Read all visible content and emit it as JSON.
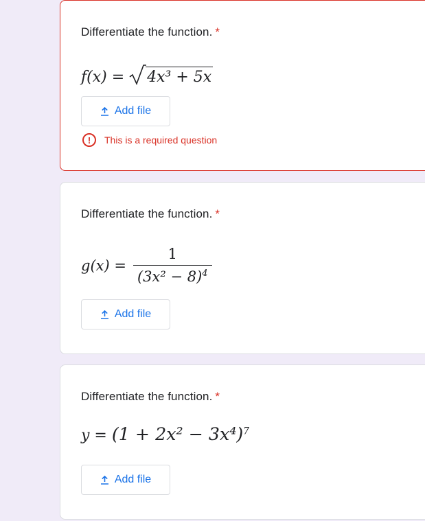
{
  "questions": [
    {
      "title": "Differentiate the function.",
      "required_mark": "*",
      "math": {
        "lhs": "f(x) =",
        "sqrt_content": "4x³ + 5x"
      },
      "add_file_label": "Add file",
      "error_text": "This is a required question"
    },
    {
      "title": "Differentiate the function.",
      "required_mark": "*",
      "math": {
        "lhs": "g(x) =",
        "numerator": "1",
        "denominator_base": "(3x² − 8)",
        "denominator_exp": "4"
      },
      "add_file_label": "Add file"
    },
    {
      "title": "Differentiate the function.",
      "required_mark": "*",
      "math": {
        "lhs": "y =",
        "base": "(1 + 2x² − 3x⁴)",
        "exp": "7"
      },
      "add_file_label": "Add file"
    }
  ],
  "colors": {
    "accent": "#1a73e8",
    "error": "#d93025",
    "background": "#f0ebf8"
  },
  "icons": {
    "upload": "upload-icon",
    "error": "error-circle-icon"
  }
}
